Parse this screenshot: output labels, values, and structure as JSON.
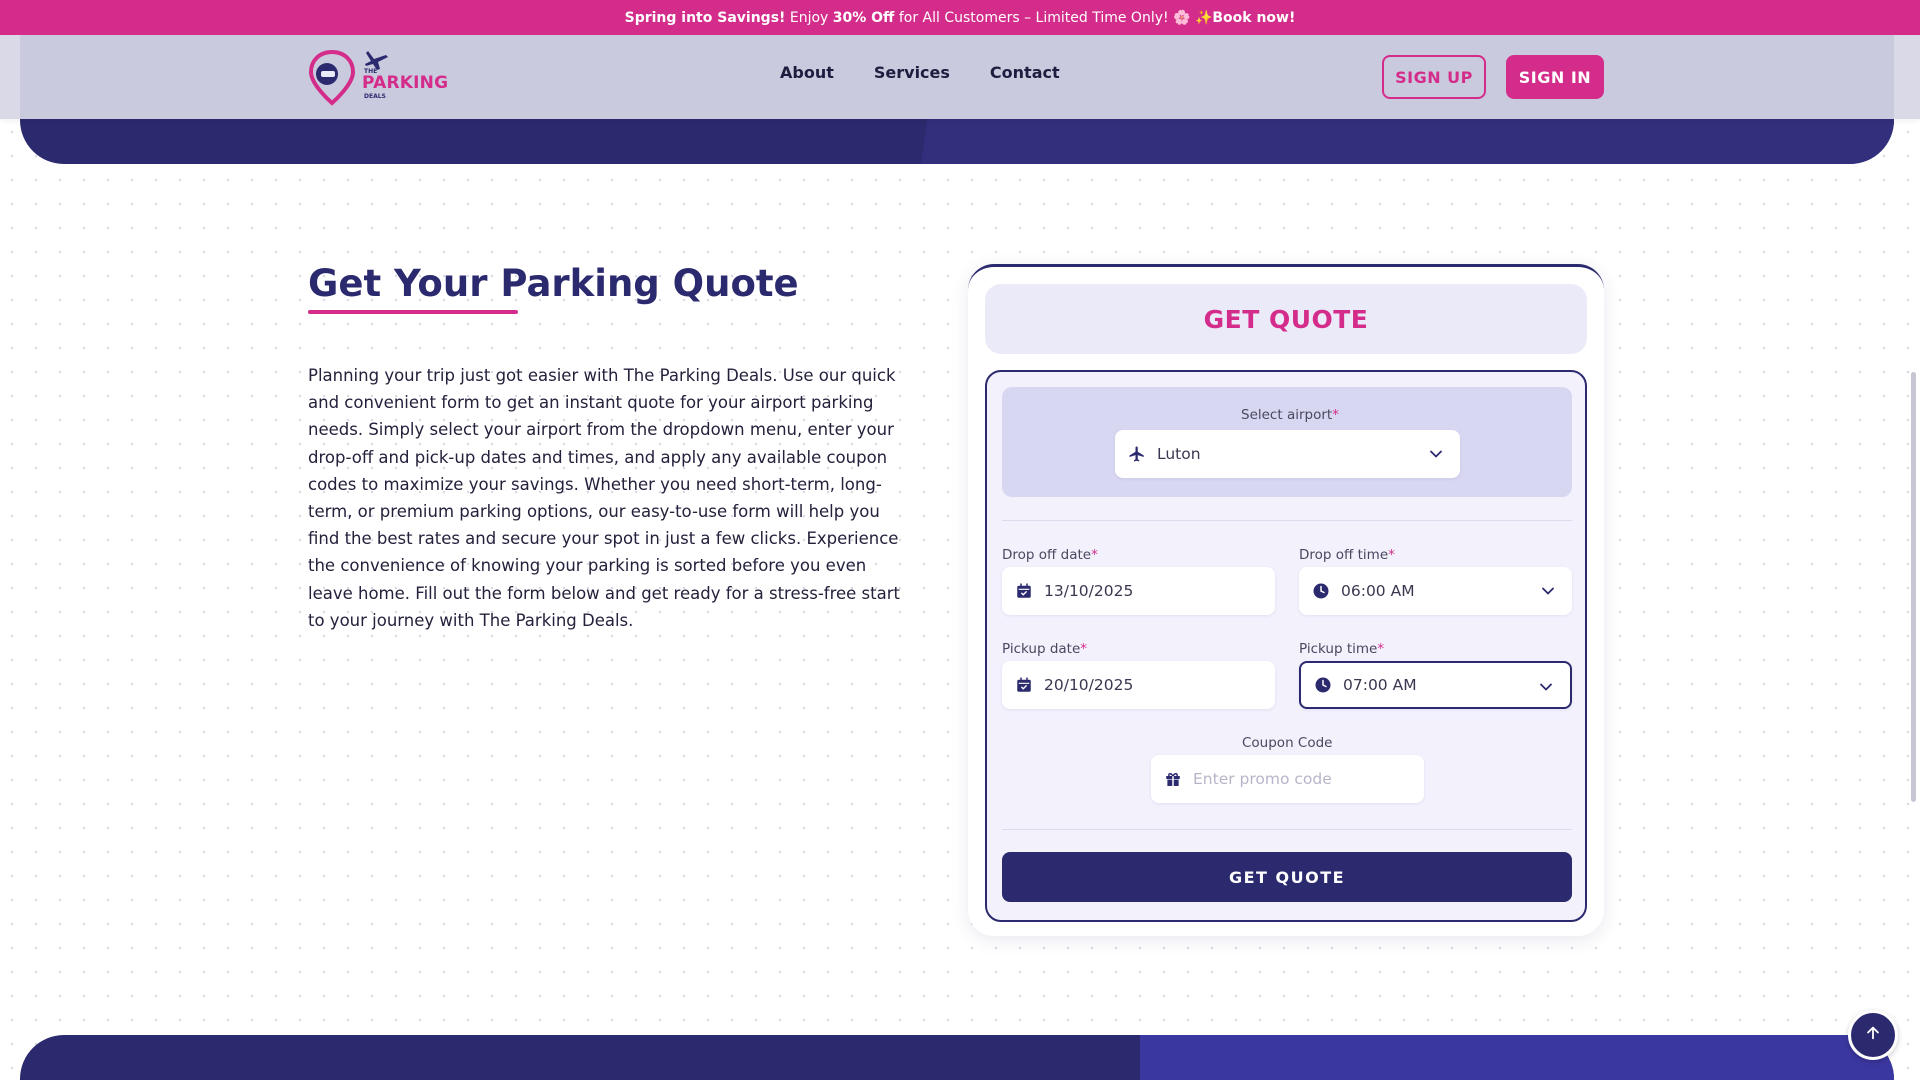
{
  "promo": {
    "part1": "Spring into Savings!",
    "part2": " Enjoy ",
    "part3": "30% Off",
    "part4": " for All Customers – Limited Time Only! 🌸 ✨",
    "part5": "Book now!"
  },
  "brand": {
    "the": "THE",
    "name": "PARKING",
    "deals": "DEALS",
    "pink": "#d42c8a",
    "navy": "#2c2a6e"
  },
  "nav": {
    "items": [
      "About",
      "Services",
      "Contact"
    ]
  },
  "auth": {
    "signup": "SIGN UP",
    "signin": "SIGN IN"
  },
  "intro": {
    "title": "Get Your Parking Quote",
    "body": "Planning your trip just got easier with The Parking Deals. Use our quick and convenient form to get an instant quote for your airport parking needs. Simply select your airport from the dropdown menu, enter your drop-off and pick-up dates and times, and apply any available coupon codes to maximize your savings. Whether you need short-term, long-term, or premium parking options, our easy-to-use form will help you find the best rates and secure your spot in just a few clicks. Experience the convenience of knowing your parking is sorted before you even leave home. Fill out the form below and get ready for a stress-free start to your journey with The Parking Deals."
  },
  "quote": {
    "header": "GET QUOTE",
    "airport_label": "Select airport",
    "airport_value": "Luton",
    "dropoff_date_label": "Drop off date",
    "dropoff_date_value": "13/10/2025",
    "dropoff_time_label": "Drop off time",
    "dropoff_time_value": "06:00 AM",
    "pickup_date_label": "Pickup date",
    "pickup_date_value": "20/10/2025",
    "pickup_time_label": "Pickup time",
    "pickup_time_value": "07:00 AM",
    "coupon_label": "Coupon Code",
    "coupon_placeholder": "Enter promo code",
    "submit_label": "GET QUOTE",
    "required_mark": "*"
  },
  "icons": {
    "airport": "airplane-icon",
    "date": "calendar-icon",
    "time": "clock-icon",
    "coupon": "gift-icon",
    "dropdown": "chevron-down-icon",
    "top": "arrow-up-icon"
  }
}
